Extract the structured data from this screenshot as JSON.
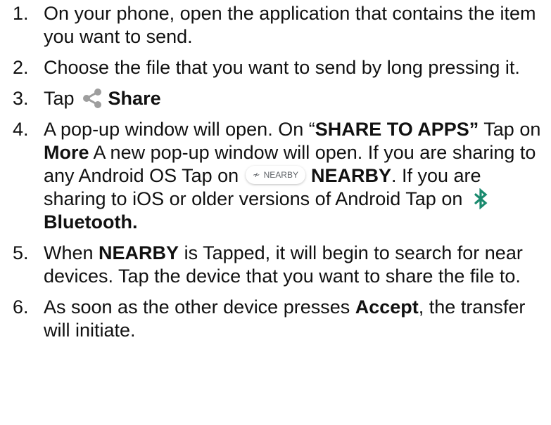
{
  "steps": [
    {
      "num": "1.",
      "text": "On your phone, open the application that contains the item you want to send."
    },
    {
      "num": "2.",
      "text": "Choose the file that you want to send by long pressing it."
    },
    {
      "num": "3.",
      "pre": "Tap",
      "icon": "share-icon",
      "bold": "Share"
    },
    {
      "num": "4.",
      "t1": "A pop-up window will open. On “",
      "b1": "SHARE TO APPS”",
      "t2": " Tap on ",
      "b2": "More",
      "t3": " A new pop-up window will open. If you are sharing to any Android OS Tap on",
      "chip_label": "NEARBY",
      "chip_icon": "nearby-icon",
      "b3": "NEARBY",
      "t4": ". If you are sharing to iOS or older versions of Android Tap on",
      "icon": "bluetooth-icon",
      "b4": "Bluetooth."
    },
    {
      "num": "5.",
      "t1": "When ",
      "b1": "NEARBY",
      "t2": " is Tapped, it will begin to search for  near devices. Tap the device that you want to share the file to."
    },
    {
      "num": "6.",
      "t1": "As soon as the other device presses ",
      "b1": "Accept",
      "t2": ", the transfer will initiate."
    }
  ],
  "colors": {
    "text": "#111111",
    "share_icon": "#9e9e9e",
    "bluetooth_icon": "#1a8a6e",
    "chip_text": "#5f6368"
  }
}
